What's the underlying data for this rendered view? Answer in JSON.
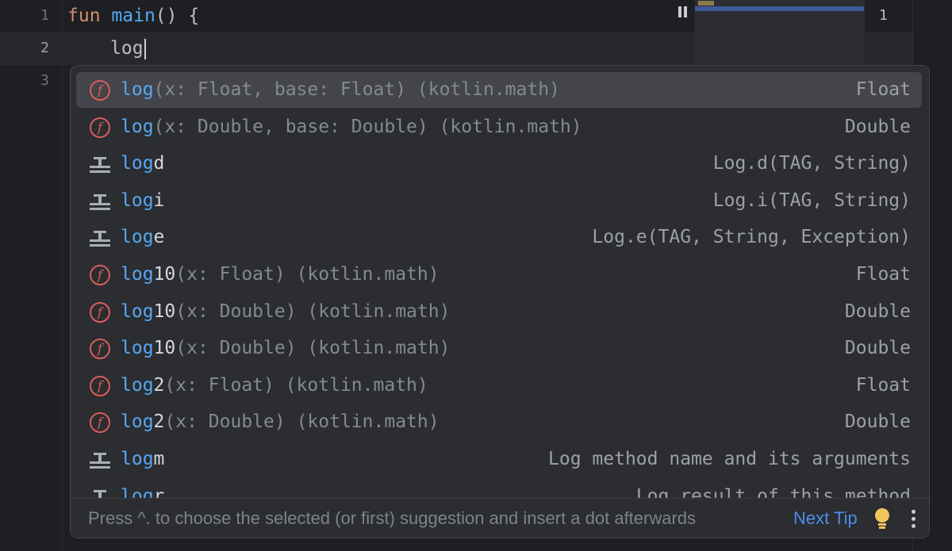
{
  "editor": {
    "line_numbers": [
      "1",
      "2",
      "3"
    ],
    "line1": {
      "kw": "fun",
      "name": "main",
      "rest": "() {"
    },
    "line2": {
      "typed": "log"
    },
    "right_gutter_number": "1"
  },
  "completion": {
    "items": [
      {
        "icon": "function-icon",
        "match": "log",
        "rest": "",
        "params": "(x: Float, base: Float) (kotlin.math)",
        "tail": "Float",
        "selected": true
      },
      {
        "icon": "function-icon",
        "match": "log",
        "rest": "",
        "params": "(x: Double, base: Double) (kotlin.math)",
        "tail": "Double"
      },
      {
        "icon": "live-template-icon",
        "match": "log",
        "rest": "d",
        "params": "",
        "tail": "Log.d(TAG, String)"
      },
      {
        "icon": "live-template-icon",
        "match": "log",
        "rest": "i",
        "params": "",
        "tail": "Log.i(TAG, String)"
      },
      {
        "icon": "live-template-icon",
        "match": "log",
        "rest": "e",
        "params": "",
        "tail": "Log.e(TAG, String, Exception)"
      },
      {
        "icon": "function-icon",
        "match": "log",
        "rest": "10",
        "params": "(x: Float) (kotlin.math)",
        "tail": "Float"
      },
      {
        "icon": "function-icon",
        "match": "log",
        "rest": "10",
        "params": "(x: Double) (kotlin.math)",
        "tail": "Double"
      },
      {
        "icon": "function-icon",
        "match": "log",
        "rest": "10",
        "params": "(x: Double) (kotlin.math)",
        "tail": "Double"
      },
      {
        "icon": "function-icon",
        "match": "log",
        "rest": "2",
        "params": "(x: Float) (kotlin.math)",
        "tail": "Float"
      },
      {
        "icon": "function-icon",
        "match": "log",
        "rest": "2",
        "params": "(x: Double) (kotlin.math)",
        "tail": "Double"
      },
      {
        "icon": "live-template-icon",
        "match": "log",
        "rest": "m",
        "params": "",
        "tail": "Log method name and its arguments"
      },
      {
        "icon": "live-template-icon",
        "match": "log",
        "rest": "r",
        "params": "",
        "tail": "Log result of this method"
      }
    ],
    "footer": {
      "hint": "Press ^. to choose the selected (or first) suggestion and insert a dot afterwards",
      "next_tip": "Next Tip"
    },
    "function_icon_glyph": "f"
  },
  "colors": {
    "background": "#1e1f22",
    "popup": "#2b2d30",
    "match": "#56a8f5",
    "keyword": "#cf8e6d",
    "function_icon": "#db5c5c",
    "link": "#4d8dea"
  }
}
